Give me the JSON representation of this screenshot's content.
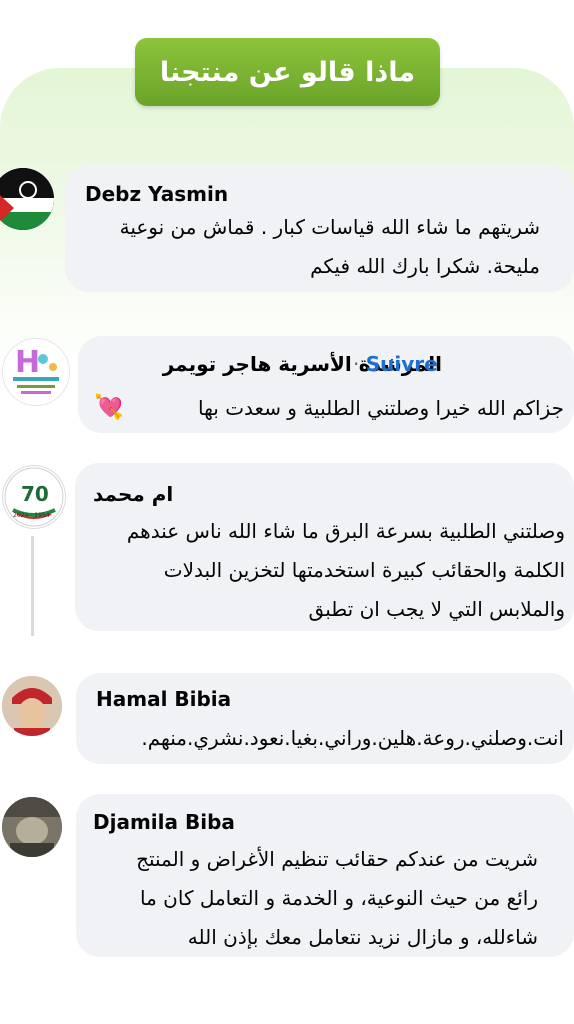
{
  "header": {
    "title": "ماذا قالو عن منتجنا"
  },
  "comments": [
    {
      "author": "Debz Yasmin",
      "lines": [
        "شريتهم ما شاء الله قياسات كبار . قماش من نوعية",
        "مليحة. شكرا بارك الله فيكم"
      ]
    },
    {
      "author": "المرشدة الأسرية هاجر تويمر",
      "follow": "Suivre",
      "separator": "·",
      "lines": [
        "جزاكم الله خيرا وصلتني الطلبية و سعدت بها"
      ],
      "emoji": "💘"
    },
    {
      "author": "ام محمد",
      "lines": [
        "وصلتني الطلبية بسرعة البرق ما شاء الله ناس عندهم",
        "الكلمة والحقائب كبيرة استخدمتها لتخزين البدلات",
        "والملابس التي لا يجب ان تطبق"
      ]
    },
    {
      "author": "Hamal Bibia",
      "lines": [
        "انت.وصلني.روعة.هلين.وراني.بغيا.نعود.نشري.منهم."
      ]
    },
    {
      "author": "Djamila Biba",
      "lines": [
        "شريت من عندكم حقائب تنظيم الأغراض و المنتج",
        "رائع من حيث النوعية، و الخدمة و التعامل كان ما",
        "شاءلله، و مازال نزيد نتعامل معك بإذن الله"
      ]
    }
  ],
  "avatars": {
    "a2_letter": "H",
    "a3_number": "70",
    "a3_years": "2024 - 1954"
  },
  "colors": {
    "accent_green": "#7ab534",
    "bubble": "#f0f2f5",
    "follow_blue": "#1f6fd1"
  }
}
